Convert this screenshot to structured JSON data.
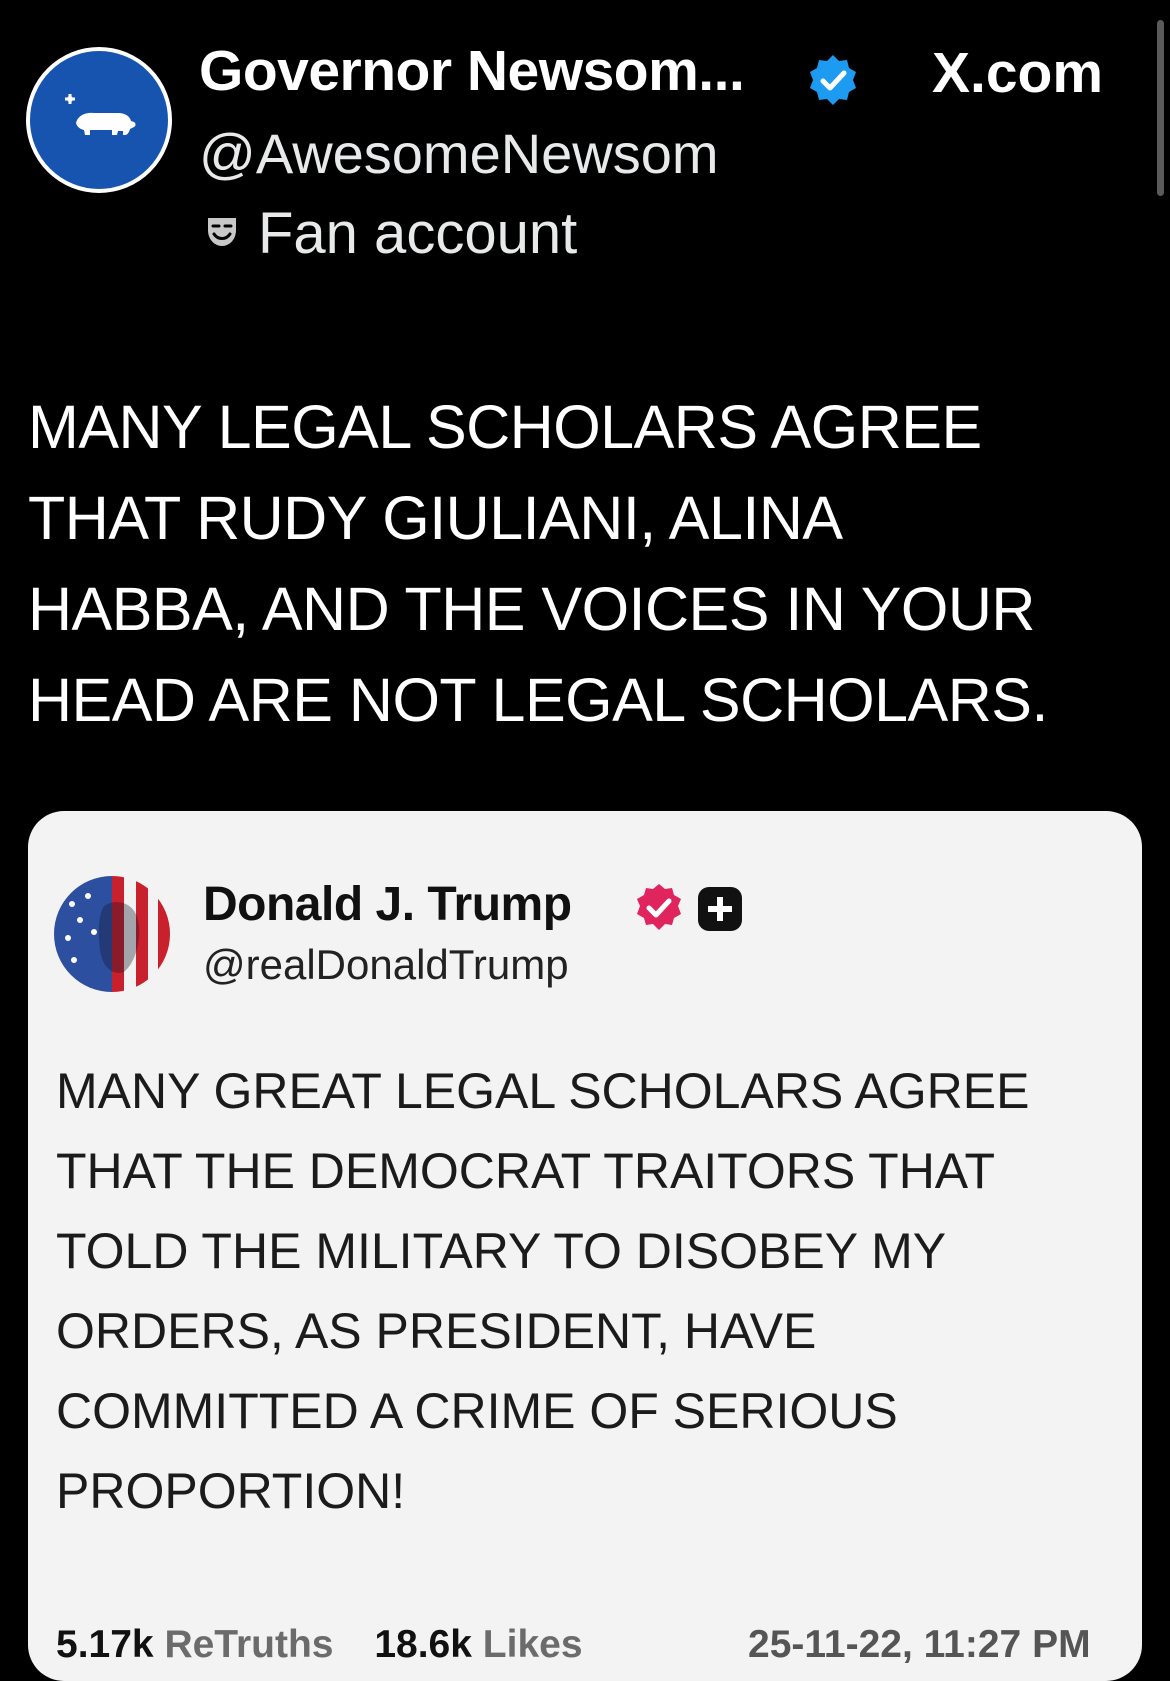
{
  "header": {
    "display_name": "Governor Newsom...",
    "handle": "@AwesomeNewsom",
    "account_label": "Fan account",
    "site_label": "X.com",
    "avatar_color": "#1754b0",
    "verified_color": "#1d9bf0"
  },
  "tweet": {
    "lines": [
      "MANY LEGAL SCHOLARS AGREE",
      "THAT RUDY GIULIANI,  ALINA",
      "HABBA, AND THE VOICES IN YOUR",
      "HEAD ARE NOT LEGAL SCHOLARS."
    ]
  },
  "quoted_post": {
    "display_name": "Donald J. Trump",
    "handle": "@realDonaldTrump",
    "badge_color": "#e0245e",
    "body_lines": [
      "MANY GREAT LEGAL SCHOLARS AGREE",
      "THAT THE DEMOCRAT TRAITORS THAT",
      "TOLD THE MILITARY TO DISOBEY MY",
      "ORDERS, AS PRESIDENT, HAVE",
      "COMMITTED A CRIME OF SERIOUS",
      "PROPORTION!"
    ],
    "retruths_count": "5.17k",
    "retruths_label": "ReTruths",
    "likes_count": "18.6k",
    "likes_label": "Likes",
    "timestamp": "25-11-22, 11:27 PM"
  }
}
